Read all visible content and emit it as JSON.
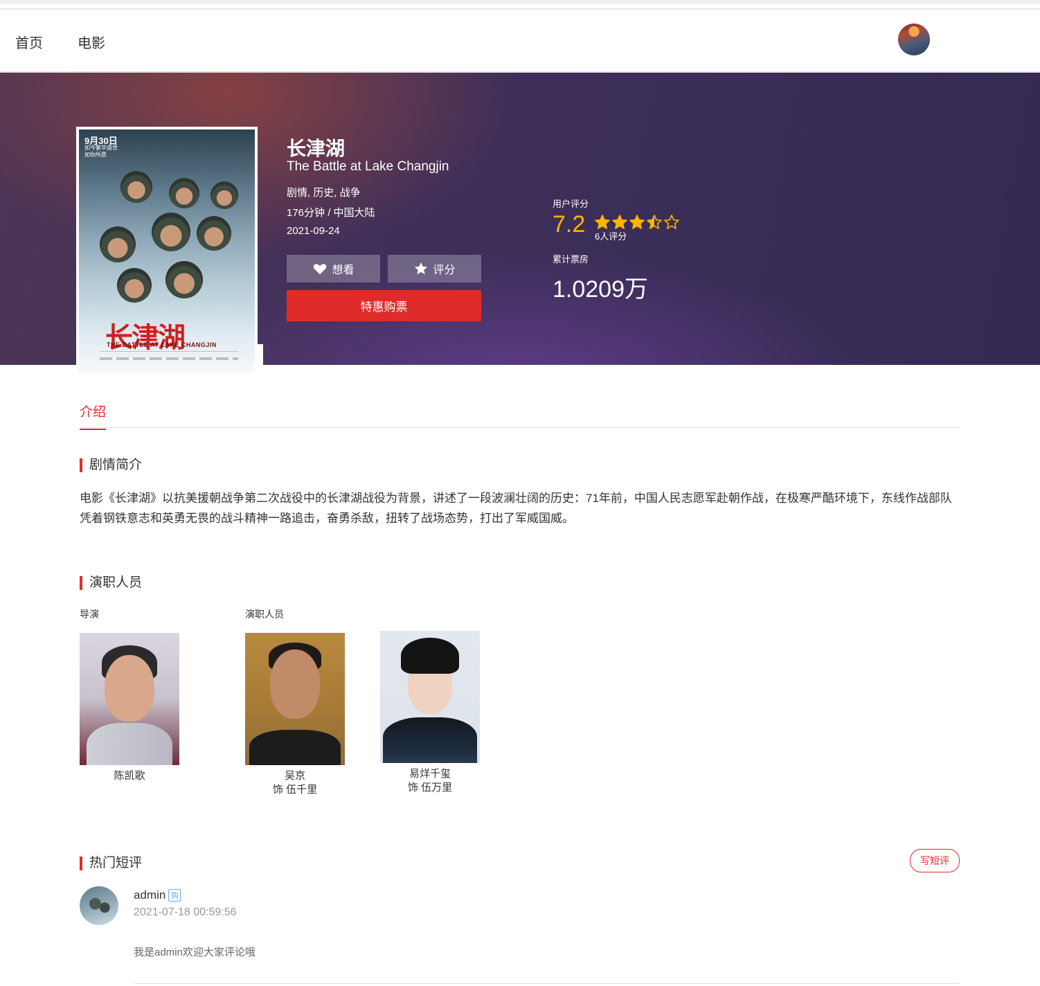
{
  "nav": {
    "home": "首页",
    "movies": "电影"
  },
  "movie": {
    "title_cn": "长津湖",
    "title_en": "The Battle at Lake Changjin",
    "genres": "剧情, 历史, 战争",
    "length_region": "176分钟 / 中国大陆",
    "release_date": "2021-09-24",
    "poster": {
      "date_text": "9月30日",
      "tagline_lines": [
        "如今繁华盛世",
        "如你所愿"
      ],
      "title_cn": "长津湖",
      "title_en": "THE BATTLE AT LAKE CHANGJIN"
    }
  },
  "actions": {
    "want_label": "想看",
    "rate_label": "评分",
    "buy_label": "特惠购票"
  },
  "rating": {
    "label": "用户评分",
    "score": "7.2",
    "stars": 3.5,
    "count_text": "6人评分",
    "box_label": "累计票房",
    "box_value": "1.0209万",
    "star_color": "#ffb400"
  },
  "tabs": {
    "intro": "介绍"
  },
  "plot": {
    "heading": "剧情简介",
    "text": "电影《长津湖》以抗美援朝战争第二次战役中的长津湖战役为背景，讲述了一段波澜壮阔的历史：71年前，中国人民志愿军赴朝作战，在极寒严酷环境下，东线作战部队凭着钢铁意志和英勇无畏的战斗精神一路追击，奋勇杀敌，扭转了战场态势，打出了军威国威。"
  },
  "cast": {
    "heading": "演职人员",
    "director_label": "导演",
    "actors_label": "演职人员",
    "director": {
      "name": "陈凯歌"
    },
    "actors": [
      {
        "name": "吴京",
        "role": "饰 伍千里"
      },
      {
        "name": "易烊千玺",
        "role": "饰 伍万里"
      }
    ]
  },
  "reviews": {
    "heading": "热门短评",
    "write_label": "写短评",
    "items": [
      {
        "user": "admin",
        "badge": "购",
        "time": "2021-07-18 00:59:56",
        "text": "我是admin欢迎大家评论哦"
      }
    ]
  },
  "colors": {
    "accent": "#e02b2b",
    "rating": "#ffb400"
  }
}
